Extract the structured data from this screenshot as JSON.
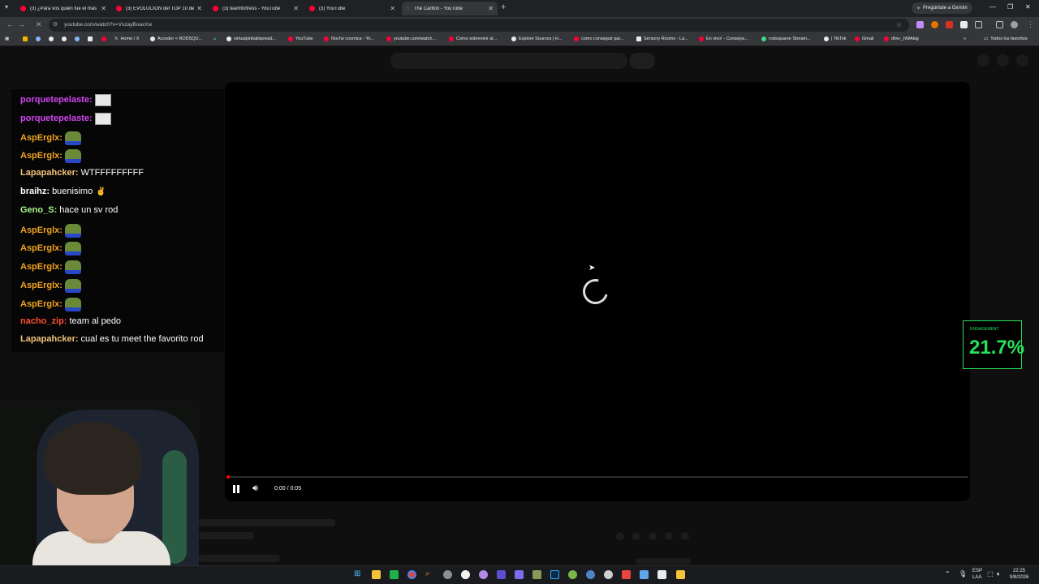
{
  "browser": {
    "tabs": [
      {
        "label": "(3) ¿Para vos quién fue el más",
        "active": false
      },
      {
        "label": "(3) EVOLUCIÓN del TOP 10 de",
        "active": false
      },
      {
        "label": "(3) teamfortress - YouTube",
        "active": false
      },
      {
        "label": "(3) YouTube",
        "active": false
      },
      {
        "label": "The Carlton - YouTube",
        "active": true
      }
    ],
    "gemini_label": "Pregúntale a Gemini",
    "url": "youtube.com/watch?v=VszayBoaxXw",
    "bookmarks": [
      "Home / X",
      "Acceder < RODSQU...",
      "virtualpinballspread...",
      "YouTube",
      "Noche cosmica - Yo...",
      "youtube.com/watch...",
      "Como sobrevivir al...",
      "Explore Sources | H...",
      "como conseguir par...",
      "Sensory Rooms - La...",
      "En vivo! - Consejos...",
      "rodsquaree Stream...",
      "| TikTok",
      "Gmail",
      "dhw-_hWAkig"
    ],
    "all_bookmarks_label": "Todos los favoritos"
  },
  "player": {
    "time": "0:00 / 0:05",
    "progress": 0.0,
    "state": "loading"
  },
  "chat": {
    "messages": [
      {
        "user": "porquetepelaste:",
        "text": "",
        "color": "#d046f0",
        "emote": "ascii"
      },
      {
        "user": "porquetepelaste:",
        "text": "",
        "color": "#d046f0",
        "emote": "ascii"
      },
      {
        "user": "AspErglx:",
        "text": "",
        "color": "#f1a31f",
        "emote": "pepe"
      },
      {
        "user": "AspErglx:",
        "text": "",
        "color": "#f1a31f",
        "emote": "pepe"
      },
      {
        "user": "Lapapahcker:",
        "text": "WTFFFFFFFFF",
        "color": "#f0c27a",
        "emote": ""
      },
      {
        "user": "braihz:",
        "text": "buenisimo",
        "color": "#ffffff",
        "emote": "hands"
      },
      {
        "user": "Geno_S:",
        "text": "hace un sv rod",
        "color": "#a8f58a",
        "emote": ""
      },
      {
        "user": "AspErglx:",
        "text": "",
        "color": "#f1a31f",
        "emote": "pepe"
      },
      {
        "user": "AspErglx:",
        "text": "",
        "color": "#f1a31f",
        "emote": "pepe"
      },
      {
        "user": "AspErglx:",
        "text": "",
        "color": "#f1a31f",
        "emote": "pepe"
      },
      {
        "user": "AspErglx:",
        "text": "",
        "color": "#f1a31f",
        "emote": "pepe"
      },
      {
        "user": "AspErglx:",
        "text": "",
        "color": "#f1a31f",
        "emote": "pepe"
      },
      {
        "user": "nacho_zip:",
        "text": "team al pedo",
        "color": "#ff4d33",
        "emote": ""
      },
      {
        "user": "Lapapahcker:",
        "text": "cual es tu meet the favorito rod",
        "color": "#f0c27a",
        "emote": ""
      }
    ]
  },
  "engagement": {
    "label": "ENGAGEMENT",
    "value": "21.7%",
    "color": "#27e15a"
  },
  "taskbar": {
    "lang_top": "ESP",
    "lang_bottom": "LAA",
    "time": "22:25",
    "date": "9/8/2026"
  }
}
